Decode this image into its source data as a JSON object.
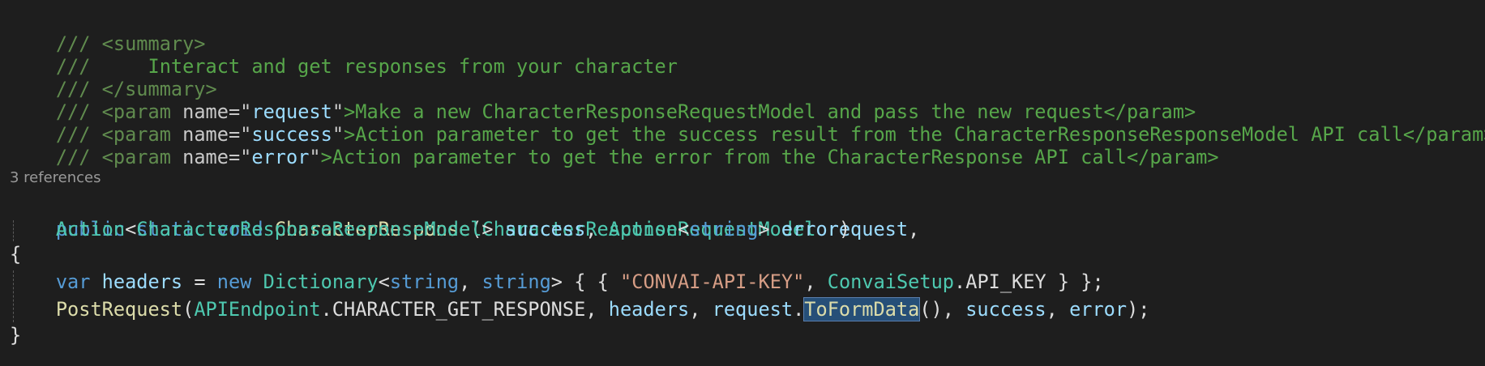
{
  "doc_comments": {
    "prefix": "///",
    "summary_open": "<summary>",
    "summary_text": "    Interact and get responses from your character",
    "summary_close": "</summary>",
    "params": [
      {
        "tag_open": "<param",
        "attr_name": "name=",
        "quote_open": "\"",
        "name": "request",
        "quote_close": "\"",
        "text": ">Make a new CharacterResponseRequestModel and pass the new request</param>"
      },
      {
        "tag_open": "<param",
        "attr_name": "name=",
        "quote_open": "\"",
        "name": "success",
        "quote_close": "\"",
        "text": ">Action parameter to get the success result from the CharacterResponseResponseModel API call</param>"
      },
      {
        "tag_open": "<param",
        "attr_name": "name=",
        "quote_open": "\"",
        "name": "error",
        "quote_close": "\"",
        "text": ">Action parameter to get the error from the CharacterResponse API call</param>"
      }
    ]
  },
  "codelens": {
    "references": "3 references"
  },
  "signature": {
    "kw_public": "public",
    "kw_static": "static",
    "kw_void": "void",
    "method_name": "CharacterResponse",
    "paren_open": "(",
    "param1_type": "CharacterResponseRequestModel",
    "param1_name": "request",
    "comma1": ",",
    "param2_type": "Action",
    "lt1": "<",
    "param2_generic": "CharacterResponseResponseModel",
    "gt1": ">",
    "param2_name": "success",
    "comma2": ",",
    "param3_type": "Action",
    "lt2": "<",
    "param3_generic": "string",
    "gt2": ">",
    "param3_name": "error",
    "paren_close": ")"
  },
  "body": {
    "brace_open": "{",
    "brace_close": "}",
    "line1": {
      "kw_var": "var",
      "var_name": "headers",
      "eq": "=",
      "kw_new": "new",
      "type_dict": "Dictionary",
      "lt": "<",
      "kw_string1": "string",
      "comma": ",",
      "kw_string2": "string",
      "gt_brace": "> { {",
      "key_string": "\"CONVAI-API-KEY\"",
      "comma2": ",",
      "class_name": "ConvaiSetup",
      "dot": ".",
      "const_name": "API_KEY",
      "end": "} };"
    },
    "line2": {
      "method": "PostRequest",
      "paren_open": "(",
      "class_name": "APIEndpoint",
      "dot": ".",
      "const_name": "CHARACTER_GET_RESPONSE",
      "comma1": ",",
      "arg_headers": "headers",
      "comma2": ",",
      "arg_request": "request",
      "dot2": ".",
      "selected_method": "ToFormData",
      "call_parens": "()",
      "comma3": ",",
      "arg_success": "success",
      "comma4": ",",
      "arg_error": "error",
      "end": ");"
    }
  },
  "colors": {
    "background": "#1e1e1e",
    "comment": "#57a64a",
    "keyword": "#569cd6",
    "type": "#4ec9b0",
    "method": "#dcdcaa",
    "parameter": "#9cdcfe",
    "string": "#d69d85",
    "selection": "#264f78"
  }
}
